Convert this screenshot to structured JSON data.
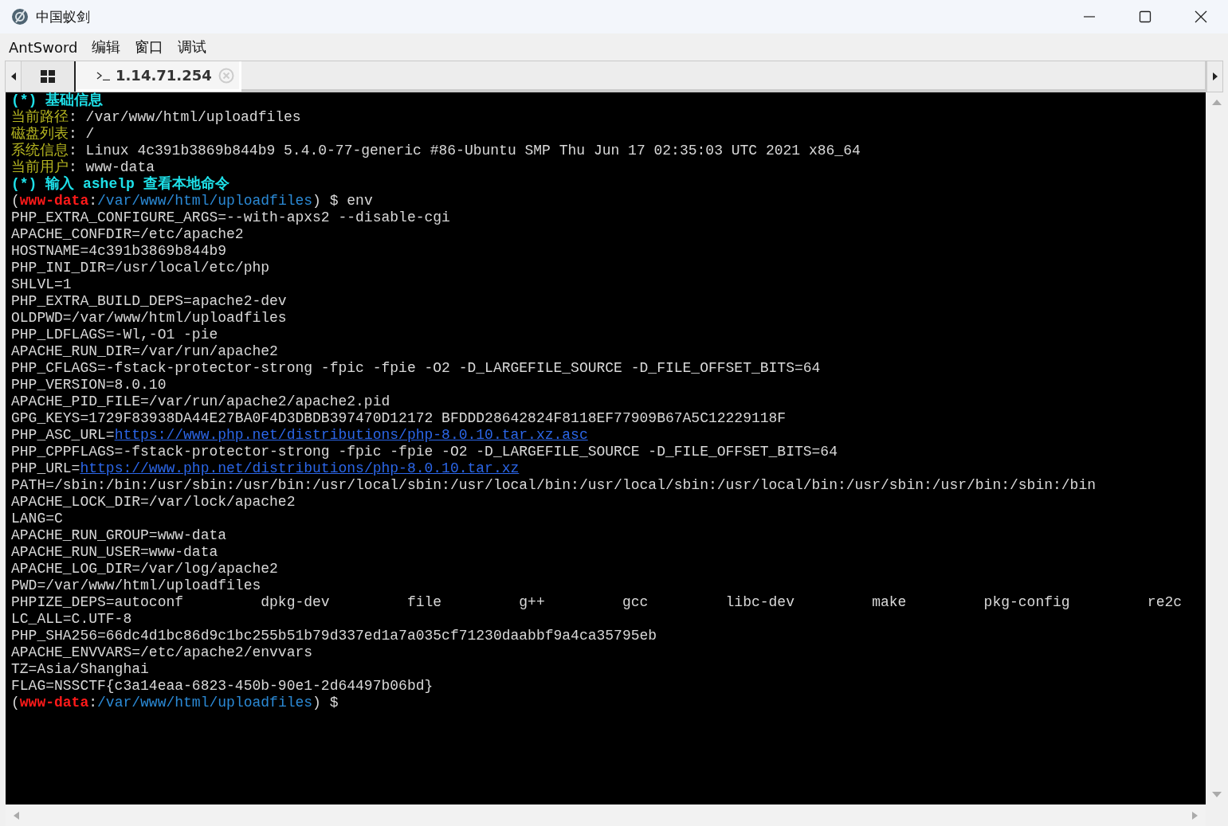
{
  "window": {
    "title": "中国蚁剑"
  },
  "menu": [
    "AntSword",
    "编辑",
    "窗口",
    "调试"
  ],
  "tabs": [
    {
      "kind": "grid",
      "selected": false
    },
    {
      "kind": "terminal",
      "label": "1.14.71.254",
      "selected": true
    }
  ],
  "terminal": {
    "lines": [
      [
        {
          "kind": "heading",
          "text": "(*) 基础信息"
        }
      ],
      [
        {
          "kind": "label",
          "text": "当前路径"
        },
        {
          "kind": "plain",
          "text": ": /var/www/html/uploadfiles"
        }
      ],
      [
        {
          "kind": "label",
          "text": "磁盘列表"
        },
        {
          "kind": "plain",
          "text": ": /"
        }
      ],
      [
        {
          "kind": "label",
          "text": "系统信息"
        },
        {
          "kind": "plain",
          "text": ": Linux 4c391b3869b844b9 5.4.0-77-generic #86-Ubuntu SMP Thu Jun 17 02:35:03 UTC 2021 x86_64"
        }
      ],
      [
        {
          "kind": "label",
          "text": "当前用户"
        },
        {
          "kind": "plain",
          "text": ": www-data"
        }
      ],
      [
        {
          "kind": "heading",
          "text": "(*) 输入 ashelp 查看本地命令"
        }
      ],
      [
        {
          "kind": "plain",
          "text": "("
        },
        {
          "kind": "user",
          "text": "www-data"
        },
        {
          "kind": "plain",
          "text": ":"
        },
        {
          "kind": "path",
          "text": "/var/www/html/uploadfiles"
        },
        {
          "kind": "plain",
          "text": ") $ env"
        }
      ],
      [
        {
          "kind": "plain",
          "text": "PHP_EXTRA_CONFIGURE_ARGS=--with-apxs2 --disable-cgi"
        }
      ],
      [
        {
          "kind": "plain",
          "text": "APACHE_CONFDIR=/etc/apache2"
        }
      ],
      [
        {
          "kind": "plain",
          "text": "HOSTNAME=4c391b3869b844b9"
        }
      ],
      [
        {
          "kind": "plain",
          "text": "PHP_INI_DIR=/usr/local/etc/php"
        }
      ],
      [
        {
          "kind": "plain",
          "text": "SHLVL=1"
        }
      ],
      [
        {
          "kind": "plain",
          "text": "PHP_EXTRA_BUILD_DEPS=apache2-dev"
        }
      ],
      [
        {
          "kind": "plain",
          "text": "OLDPWD=/var/www/html/uploadfiles"
        }
      ],
      [
        {
          "kind": "plain",
          "text": "PHP_LDFLAGS=-Wl,-O1 -pie"
        }
      ],
      [
        {
          "kind": "plain",
          "text": "APACHE_RUN_DIR=/var/run/apache2"
        }
      ],
      [
        {
          "kind": "plain",
          "text": "PHP_CFLAGS=-fstack-protector-strong -fpic -fpie -O2 -D_LARGEFILE_SOURCE -D_FILE_OFFSET_BITS=64"
        }
      ],
      [
        {
          "kind": "plain",
          "text": "PHP_VERSION=8.0.10"
        }
      ],
      [
        {
          "kind": "plain",
          "text": "APACHE_PID_FILE=/var/run/apache2/apache2.pid"
        }
      ],
      [
        {
          "kind": "plain",
          "text": "GPG_KEYS=1729F83938DA44E27BA0F4D3DBDB397470D12172 BFDDD28642824F8118EF77909B67A5C12229118F"
        }
      ],
      [
        {
          "kind": "plain",
          "text": "PHP_ASC_URL="
        },
        {
          "kind": "link",
          "text": "https://www.php.net/distributions/php-8.0.10.tar.xz.asc"
        }
      ],
      [
        {
          "kind": "plain",
          "text": "PHP_CPPFLAGS=-fstack-protector-strong -fpic -fpie -O2 -D_LARGEFILE_SOURCE -D_FILE_OFFSET_BITS=64"
        }
      ],
      [
        {
          "kind": "plain",
          "text": "PHP_URL="
        },
        {
          "kind": "link",
          "text": "https://www.php.net/distributions/php-8.0.10.tar.xz"
        }
      ],
      [
        {
          "kind": "plain",
          "text": "PATH=/sbin:/bin:/usr/sbin:/usr/bin:/usr/local/sbin:/usr/local/bin:/usr/local/sbin:/usr/local/bin:/usr/sbin:/usr/bin:/sbin:/bin"
        }
      ],
      [
        {
          "kind": "plain",
          "text": "APACHE_LOCK_DIR=/var/lock/apache2"
        }
      ],
      [
        {
          "kind": "plain",
          "text": "LANG=C"
        }
      ],
      [
        {
          "kind": "plain",
          "text": "APACHE_RUN_GROUP=www-data"
        }
      ],
      [
        {
          "kind": "plain",
          "text": "APACHE_RUN_USER=www-data"
        }
      ],
      [
        {
          "kind": "plain",
          "text": "APACHE_LOG_DIR=/var/log/apache2"
        }
      ],
      [
        {
          "kind": "plain",
          "text": "PWD=/var/www/html/uploadfiles"
        }
      ],
      [
        {
          "kind": "plain",
          "text": "PHPIZE_DEPS=autoconf         dpkg-dev         file         g++         gcc         libc-dev         make         pkg-config         re2c"
        }
      ],
      [
        {
          "kind": "plain",
          "text": "LC_ALL=C.UTF-8"
        }
      ],
      [
        {
          "kind": "plain",
          "text": "PHP_SHA256=66dc4d1bc86d9c1bc255b51b79d337ed1a7a035cf71230daabbf9a4ca35795eb"
        }
      ],
      [
        {
          "kind": "plain",
          "text": "APACHE_ENVVARS=/etc/apache2/envvars"
        }
      ],
      [
        {
          "kind": "plain",
          "text": "TZ=Asia/Shanghai"
        }
      ],
      [
        {
          "kind": "plain",
          "text": "FLAG=NSSCTF{c3a14eaa-6823-450b-90e1-2d64497b06bd}"
        }
      ],
      [
        {
          "kind": "plain",
          "text": "("
        },
        {
          "kind": "user",
          "text": "www-data"
        },
        {
          "kind": "plain",
          "text": ":"
        },
        {
          "kind": "path",
          "text": "/var/www/html/uploadfiles"
        },
        {
          "kind": "plain",
          "text": ") $"
        }
      ]
    ]
  }
}
